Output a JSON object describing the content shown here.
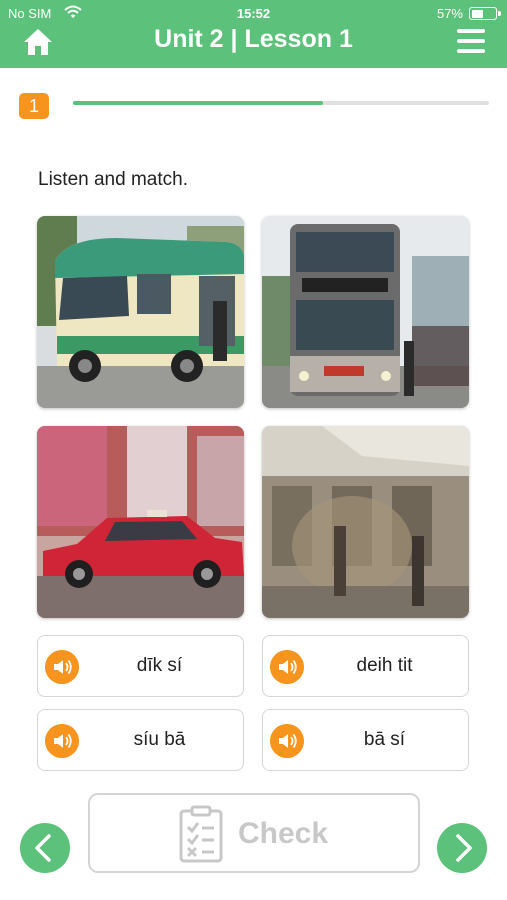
{
  "status_bar": {
    "carrier": "No SIM",
    "time": "15:52",
    "battery": "57%",
    "battery_level": 0.57
  },
  "header": {
    "title": "Unit 2 | Lesson 1"
  },
  "progress": {
    "step": "1",
    "fraction": 0.6
  },
  "instruction": "Listen and match.",
  "photos": [
    {
      "subject": "green minibus"
    },
    {
      "subject": "double-decker bus"
    },
    {
      "subject": "red taxi"
    },
    {
      "subject": "MTR train"
    }
  ],
  "words": [
    {
      "label": "dīk sí"
    },
    {
      "label": "deih tit"
    },
    {
      "label": "síu bā"
    },
    {
      "label": "bā sí"
    }
  ],
  "check": {
    "label": "Check"
  },
  "colors": {
    "header": "#5cc17a",
    "accent": "#f7941d",
    "disabled_text": "#c8c8c8"
  }
}
